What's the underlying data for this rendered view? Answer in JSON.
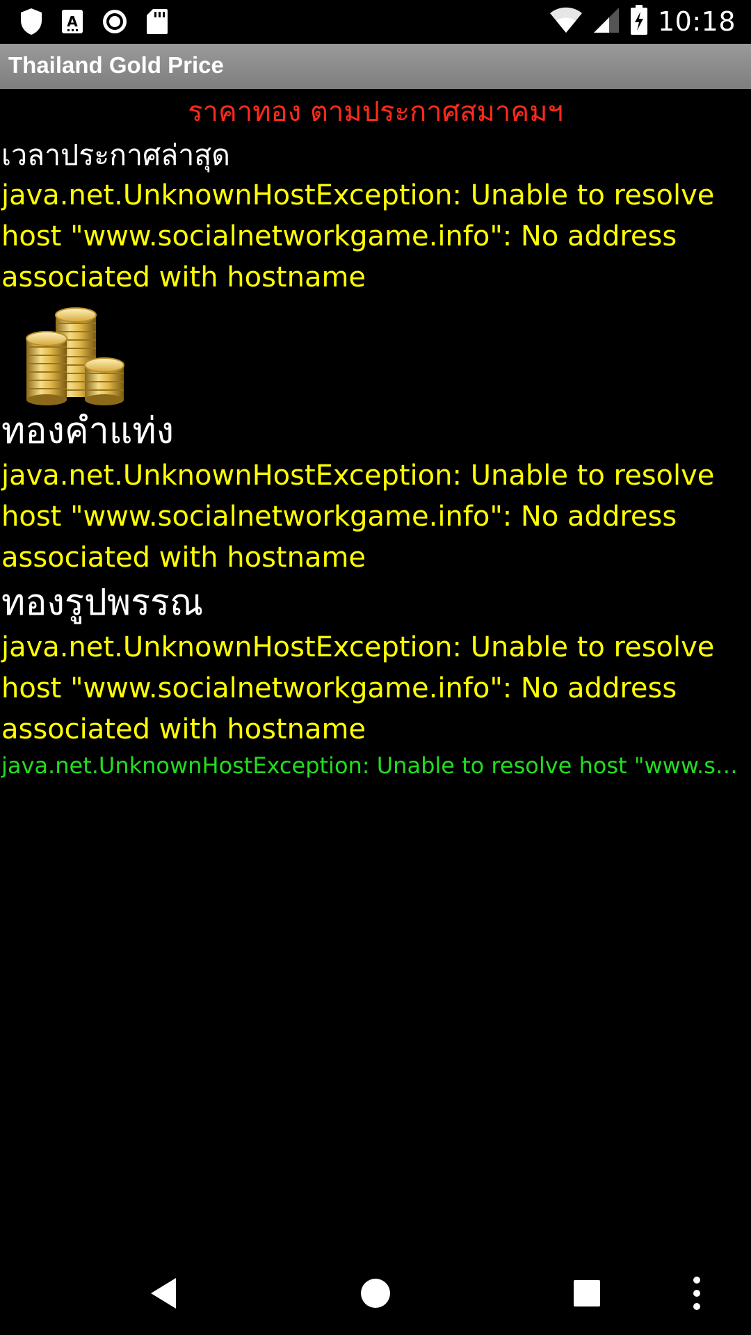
{
  "status_bar": {
    "time": "10:18",
    "icons": [
      "shield-icon",
      "text-a-icon",
      "record-icon",
      "sd-card-icon",
      "wifi-icon",
      "signal-icon",
      "battery-charging-icon"
    ]
  },
  "app": {
    "title": "Thailand Gold Price"
  },
  "main": {
    "header": "ราคาทอง ตามประกาศสมาคมฯ",
    "latest_time_label": "เวลาประกาศล่าสุด",
    "latest_time_value": "java.net.UnknownHostException: Unable to resolve host \"www.socialnetworkgame.info\": No address associated with hostname",
    "gold_bar_label": "ทองคำแท่ง",
    "gold_bar_value": "java.net.UnknownHostException: Unable to resolve host \"www.socialnetworkgame.info\": No address associated with hostname",
    "gold_jewelry_label": "ทองรูปพรรณ",
    "gold_jewelry_value": "java.net.UnknownHostException: Unable to resolve host \"www.socialnetworkgame.info\": No address associated with hostname",
    "footer_error": "java.net.UnknownHostException: Unable to resolve host \"www.socialnetworkgame.info\": No address associated with hostname"
  },
  "colors": {
    "header": "#ff2a1a",
    "value_text": "#ffff00",
    "footer_text": "#22dd22",
    "title_bar": "#8c8c8c"
  },
  "nav_bar": {
    "buttons": [
      "back-icon",
      "home-icon",
      "recents-icon",
      "more-icon"
    ]
  }
}
